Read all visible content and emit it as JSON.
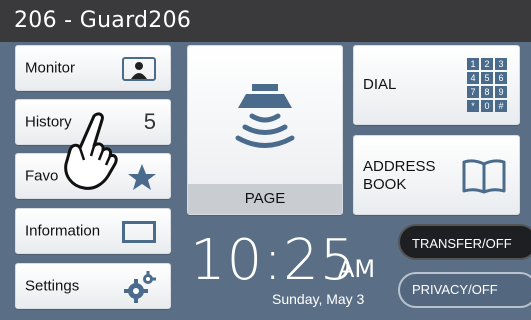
{
  "header": {
    "title": "206 - Guard206"
  },
  "side_buttons": {
    "monitor": "Monitor",
    "history": "History",
    "history_count": "5",
    "favorites": "Favo",
    "information": "Information",
    "settings": "Settings"
  },
  "page_button": {
    "label": "PAGE"
  },
  "dial_button": {
    "label": "DIAL",
    "keypad": [
      "1",
      "2",
      "3",
      "4",
      "5",
      "6",
      "7",
      "8",
      "9",
      "*",
      "0",
      "#"
    ]
  },
  "address_book_button": {
    "line1": "ADDRESS",
    "line2": "BOOK"
  },
  "clock": {
    "time": "10:25",
    "ampm": "AM",
    "date": "Sunday, May 3"
  },
  "toggles": {
    "transfer": "TRANSFER/OFF",
    "privacy": "PRIVACY/OFF"
  },
  "colors": {
    "background": "#5a6f86",
    "titlebar": "#3a3a3d",
    "accent_icon": "#4a6b8c"
  },
  "icons": [
    "person-card-icon",
    "star-icon",
    "screen-icon",
    "gear-icon",
    "speaker-icon",
    "keypad-icon",
    "book-icon",
    "hand-cursor-icon"
  ]
}
